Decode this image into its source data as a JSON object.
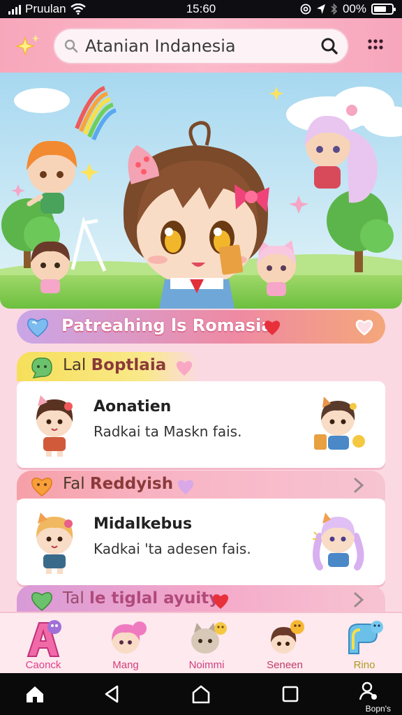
{
  "status_bar": {
    "carrier": "Pruulan",
    "time": "15:60",
    "battery": "00%",
    "battery_fraction": 0.7,
    "icons": [
      "signal-bars-icon",
      "wifi-icon",
      "at-icon",
      "location-arrow-icon",
      "bluetooth-icon",
      "battery-icon"
    ]
  },
  "header": {
    "search_placeholder": "Atanian Indanesia",
    "icons": [
      "sparkle-icon",
      "search-icon",
      "more-dots-icon"
    ]
  },
  "banner": {
    "description_icons": [
      "chibi-girl-main",
      "chibi-boy-left",
      "chibi-girl-right",
      "rainbow-icon",
      "cloud-icon",
      "tree-icon",
      "star-icon"
    ]
  },
  "featured_header": {
    "label": "Patreahing ls Romasia",
    "icons": [
      "heart-gem-icon",
      "heart-icon",
      "heart-outline-icon"
    ]
  },
  "sections": [
    {
      "tab_prefix": "Lal",
      "tab_name": "Boptlaia",
      "title": "Aonatien",
      "subtitle": "Radkai ta Maskn fais.",
      "icons": [
        "blob-icon",
        "heart-icon",
        "chevron-right-icon"
      ]
    },
    {
      "tab_prefix": "Fal",
      "tab_name": "Reddyish",
      "title": "Midalkebus",
      "subtitle": "Kadkai 'ta adesen fais.",
      "icons": [
        "heart-icon",
        "heart-icon",
        "chevron-right-icon"
      ]
    },
    {
      "tab_prefix": "Tal",
      "tab_name": "le tiglal ayuity",
      "icons": [
        "heart-icon",
        "heart-icon",
        "chevron-right-icon"
      ]
    }
  ],
  "tabbar": {
    "items": [
      {
        "label": "Caonck",
        "icon": "letter-a-icon",
        "color": "#e0408a"
      },
      {
        "label": "Mang",
        "icon": "chibi-pink-icon",
        "color": "#d0407a"
      },
      {
        "label": "Noimmi",
        "icon": "chibi-cat-icon",
        "color": "#d04080"
      },
      {
        "label": "Seneen",
        "icon": "chibi-brown-icon",
        "color": "#c03a6a"
      },
      {
        "label": "Rino",
        "icon": "rainbow-letter-icon",
        "color": "#b09a20"
      }
    ]
  },
  "nav_bar": {
    "items": [
      "home-icon",
      "back-icon",
      "circle-home-icon",
      "recents-icon",
      "profile-icon"
    ],
    "profile_label": "Bopn's"
  },
  "colors": {
    "accent_pink": "#f7a6bc",
    "background": "#fbd9e3",
    "header_gradient_start": "#a7d8f0",
    "header_gradient_end": "#ef8aa2"
  }
}
